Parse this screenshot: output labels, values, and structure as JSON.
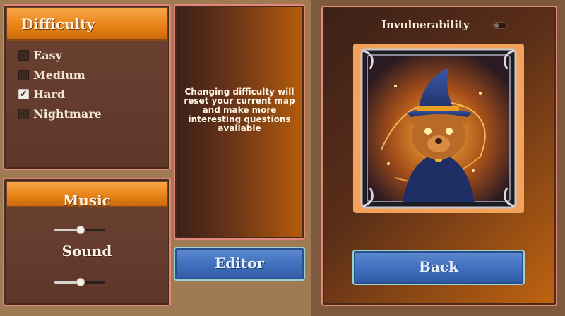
{
  "difficulty": {
    "title": "Difficulty",
    "options": [
      {
        "label": "Easy",
        "checked": false
      },
      {
        "label": "Medium",
        "checked": false
      },
      {
        "label": "Hard",
        "checked": true
      },
      {
        "label": "Nightmare",
        "checked": false
      }
    ]
  },
  "audio": {
    "music_label": "Music",
    "music_level": 0.5,
    "sound_label": "Sound",
    "sound_level": 0.5
  },
  "info": {
    "message": "Changing difficulty will reset your current map and make more interesting questions available"
  },
  "editor_button": "Editor",
  "invulnerability": {
    "label": "Invulnerability",
    "enabled": false
  },
  "character_card": {
    "icon": "wizard-bear-portrait"
  },
  "back_button": "Back",
  "colors": {
    "accent_orange": "#e98316",
    "panel_border": "#e3877a",
    "button_blue": "#3f6fbd"
  }
}
